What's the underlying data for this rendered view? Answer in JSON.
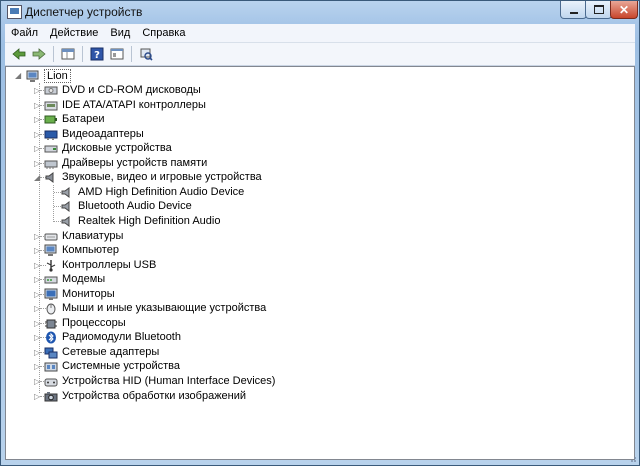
{
  "window": {
    "title": "Диспетчер устройств",
    "controls": {
      "minimize": "minimize",
      "maximize": "maximize",
      "close": "✕"
    }
  },
  "menu": [
    {
      "label": "Файл"
    },
    {
      "label": "Действие"
    },
    {
      "label": "Вид"
    },
    {
      "label": "Справка"
    }
  ],
  "toolbar": [
    "back-arrow-icon",
    "forward-arrow-icon",
    "properties-icon",
    "help-icon",
    "show-hide-console-tree-icon",
    "scan-hardware-icon"
  ],
  "tree": {
    "root": "Lion",
    "categories": [
      {
        "label": "DVD и CD-ROM дисководы",
        "icon": "dvd-drive-icon",
        "expanded": false
      },
      {
        "label": "IDE ATA/ATAPI контроллеры",
        "icon": "ide-controller-icon",
        "expanded": false
      },
      {
        "label": "Батареи",
        "icon": "battery-icon",
        "expanded": false
      },
      {
        "label": "Видеоадаптеры",
        "icon": "display-adapter-icon",
        "expanded": false
      },
      {
        "label": "Дисковые устройства",
        "icon": "disk-drive-icon",
        "expanded": false
      },
      {
        "label": "Драйверы устройств памяти",
        "icon": "memory-device-icon",
        "expanded": false
      },
      {
        "label": "Звуковые, видео и игровые устройства",
        "icon": "sound-device-icon",
        "expanded": true,
        "children": [
          {
            "label": "AMD High Definition Audio Device",
            "icon": "speaker-icon"
          },
          {
            "label": "Bluetooth Audio Device",
            "icon": "speaker-icon"
          },
          {
            "label": "Realtek High Definition Audio",
            "icon": "speaker-icon"
          }
        ]
      },
      {
        "label": "Клавиатуры",
        "icon": "keyboard-icon",
        "expanded": false
      },
      {
        "label": "Компьютер",
        "icon": "computer-icon",
        "expanded": false
      },
      {
        "label": "Контроллеры USB",
        "icon": "usb-icon",
        "expanded": false
      },
      {
        "label": "Модемы",
        "icon": "modem-icon",
        "expanded": false
      },
      {
        "label": "Мониторы",
        "icon": "monitor-icon",
        "expanded": false
      },
      {
        "label": "Мыши и иные указывающие устройства",
        "icon": "mouse-icon",
        "expanded": false
      },
      {
        "label": "Процессоры",
        "icon": "processor-icon",
        "expanded": false
      },
      {
        "label": "Радиомодули Bluetooth",
        "icon": "bluetooth-icon",
        "expanded": false
      },
      {
        "label": "Сетевые адаптеры",
        "icon": "network-adapter-icon",
        "expanded": false
      },
      {
        "label": "Системные устройства",
        "icon": "system-device-icon",
        "expanded": false
      },
      {
        "label": "Устройства HID (Human Interface Devices)",
        "icon": "hid-icon",
        "expanded": false
      },
      {
        "label": "Устройства обработки изображений",
        "icon": "imaging-device-icon",
        "expanded": false
      }
    ]
  },
  "colors": {
    "titlebar": "#a7c6e8",
    "tree_bg": "#ffffff",
    "close_button": "#c8452b"
  }
}
